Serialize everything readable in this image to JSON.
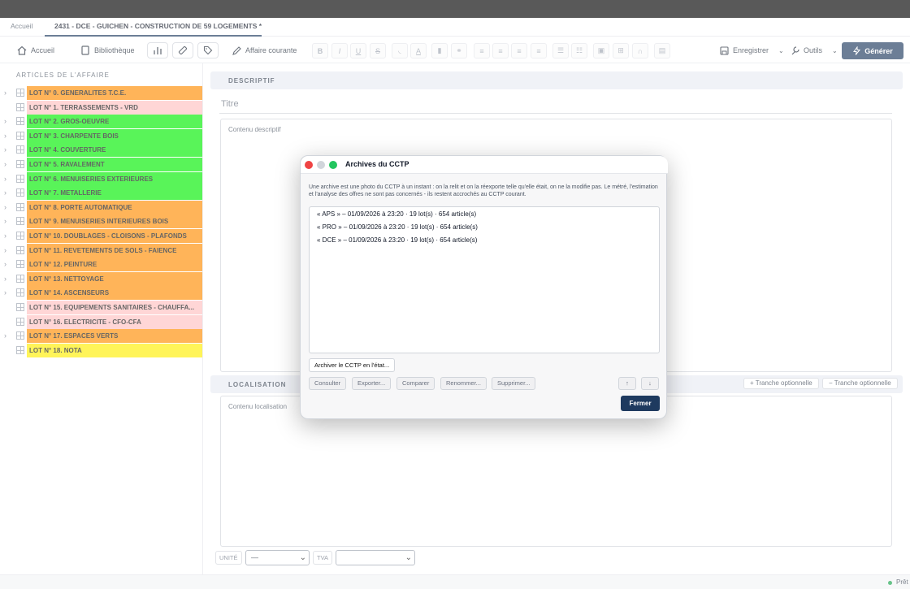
{
  "tabs": [
    {
      "label": "Accueil"
    },
    {
      "label": "2431 - DCE - GUICHEN - CONSTRUCTION DE 59 LOGEMENTS *"
    }
  ],
  "toolbar": {
    "accueil": "Accueil",
    "bibliotheque": "Bibliothèque",
    "affaire_courante": "Affaire courante",
    "enregistrer": "Enregistrer",
    "outils": "Outils",
    "generer": "Générer"
  },
  "sidebar": {
    "title": "ARTICLES DE L'AFFAIRE",
    "lots": [
      {
        "label": "LOT N° 0. GENERALITES T.C.E.",
        "color": "#ff8c00",
        "expandable": true
      },
      {
        "label": "LOT N° 1. TERRASSEMENTS - VRD",
        "color": "#ffc0c0",
        "expandable": false
      },
      {
        "label": "LOT N° 2. GROS-OEUVRE",
        "color": "#00ee00",
        "expandable": true
      },
      {
        "label": "LOT N° 3. CHARPENTE BOIS",
        "color": "#00ee00",
        "expandable": true
      },
      {
        "label": "LOT N° 4. COUVERTURE",
        "color": "#00ee00",
        "expandable": true
      },
      {
        "label": "LOT N° 5. RAVALEMENT",
        "color": "#00ee00",
        "expandable": true
      },
      {
        "label": "LOT N° 6. MENUISERIES EXTERIEURES",
        "color": "#00ee00",
        "expandable": true
      },
      {
        "label": "LOT N° 7. METALLERIE",
        "color": "#00ee00",
        "expandable": true
      },
      {
        "label": "LOT N° 8. PORTE AUTOMATIQUE",
        "color": "#ff8c00",
        "expandable": true
      },
      {
        "label": "LOT N° 9. MENUISERIES INTERIEURES BOIS",
        "color": "#ff8c00",
        "expandable": true
      },
      {
        "label": "LOT N° 10. DOUBLAGES - CLOISONS - PLAFONDS",
        "color": "#ff8c00",
        "expandable": true
      },
      {
        "label": "LOT N° 11. REVETEMENTS DE SOLS - FAIENCE",
        "color": "#ff8c00",
        "expandable": true
      },
      {
        "label": "LOT N° 12. PEINTURE",
        "color": "#ff8c00",
        "expandable": true
      },
      {
        "label": "LOT N° 13. NETTOYAGE",
        "color": "#ff8c00",
        "expandable": true
      },
      {
        "label": "LOT N° 14. ASCENSEURS",
        "color": "#ff8c00",
        "expandable": true
      },
      {
        "label": "LOT N° 15. EQUIPEMENTS SANITAIRES - CHAUFFA...",
        "color": "#ffc0c0",
        "expandable": false
      },
      {
        "label": "LOT N° 16. ELECTRICITE - CFO-CFA",
        "color": "#ffc0c0",
        "expandable": false
      },
      {
        "label": "LOT N° 17. ESPACES VERTS",
        "color": "#ff8c00",
        "expandable": true
      },
      {
        "label": "LOT N° 18. NOTA",
        "color": "#ffee00",
        "expandable": false
      }
    ]
  },
  "main": {
    "descriptif_header": "DESCRIPTIF",
    "titre_placeholder": "Titre",
    "contenu_descriptif": "Contenu descriptif",
    "localisation_header": "LOCALISATION",
    "tranche_add": "+ Tranche optionnelle",
    "tranche_remove": "− Tranche optionnelle",
    "contenu_localisation": "Contenu localisation",
    "unite_label": "UNITÉ",
    "unite_value": "—",
    "tva_label": "TVA",
    "tva_value": ""
  },
  "status": {
    "text": "Prêt",
    "color": "#16a34a"
  },
  "modal": {
    "title": "Archives du CCTP",
    "description": "Une archive est une photo du CCTP à un instant : on la relit et on la réexporte telle qu'elle était, on ne la modifie pas. Le métré, l'estimation et l'analyse des offres ne sont pas concernés - ils restent accrochés au CCTP courant.",
    "archives": [
      {
        "text": "« APS »  –  01/09/2026 à 23:20  ·  19 lot(s) · 654 article(s)"
      },
      {
        "text": "« PRO »  –  01/09/2026 à 23:20  ·  19 lot(s) · 654 article(s)"
      },
      {
        "text": "« DCE »  –  01/09/2026 à 23:20  ·  19 lot(s) · 654 article(s)"
      }
    ],
    "archiver": "Archiver le CCTP en l'état...",
    "consulter": "Consulter",
    "exporter": "Exporter...",
    "comparer": "Comparer",
    "renommer": "Renommer...",
    "supprimer": "Supprimer...",
    "up": "↑",
    "down": "↓",
    "fermer": "Fermer"
  }
}
